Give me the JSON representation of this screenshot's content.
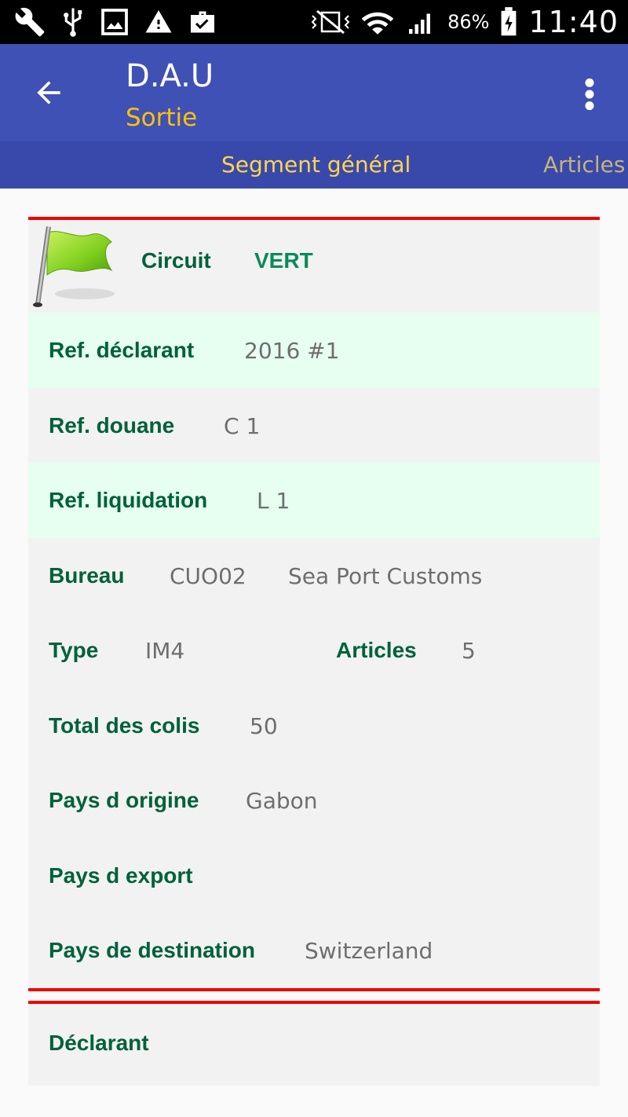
{
  "status_bar": {
    "battery_percent": "86%",
    "time": "11:40",
    "icons": [
      "wrench-icon",
      "usb-icon",
      "image-icon",
      "warning-icon",
      "briefcase-check-icon",
      "vibrate-mute-icon",
      "wifi-icon",
      "signal-icon",
      "battery-charging-icon"
    ]
  },
  "app_bar": {
    "title": "D.A.U",
    "subtitle": "Sortie",
    "colors": {
      "background": "#3f51b5",
      "subtitle": "#ffc107"
    }
  },
  "tabs": [
    {
      "label": "Segment général",
      "active": true
    },
    {
      "label": "Articles",
      "active": false
    }
  ],
  "circuit": {
    "label": "Circuit",
    "value": "VERT",
    "icon": "green-flag-icon"
  },
  "fields": {
    "ref_declarant": {
      "label": "Ref. déclarant",
      "value": "2016 #1"
    },
    "ref_douane": {
      "label": "Ref. douane",
      "value": "C 1"
    },
    "ref_liquidation": {
      "label": "Ref. liquidation",
      "value": "L 1"
    },
    "bureau": {
      "label": "Bureau",
      "code": "CUO02",
      "name": "Sea Port Customs"
    },
    "type": {
      "label": "Type",
      "value": "IM4"
    },
    "articles": {
      "label": "Articles",
      "value": "5"
    },
    "total_colis": {
      "label": "Total des colis",
      "value": "50"
    },
    "pays_origine": {
      "label": "Pays d origine",
      "value": "Gabon"
    },
    "pays_export": {
      "label": "Pays d export",
      "value": ""
    },
    "pays_destination": {
      "label": "Pays de destination",
      "value": "Switzerland"
    }
  },
  "declarant_section": {
    "label": "Déclarant"
  }
}
